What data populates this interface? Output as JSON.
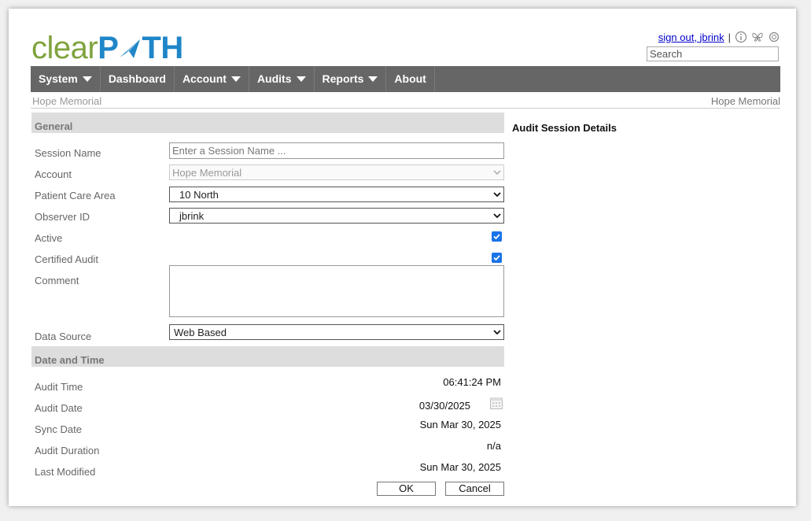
{
  "logo": {
    "part1": "clear",
    "part2": "P",
    "part3": "TH"
  },
  "user": {
    "signout": "sign out, jbrink",
    "separator": "|"
  },
  "search": {
    "placeholder": "Search"
  },
  "nav": [
    {
      "label": "System",
      "dropdown": true
    },
    {
      "label": "Dashboard",
      "dropdown": false
    },
    {
      "label": "Account",
      "dropdown": true
    },
    {
      "label": "Audits",
      "dropdown": true
    },
    {
      "label": "Reports",
      "dropdown": true
    },
    {
      "label": "About",
      "dropdown": false
    }
  ],
  "breadcrumb": {
    "left": "Hope Memorial",
    "right": "Hope Memorial"
  },
  "general": {
    "title": "General",
    "session_name": {
      "label": "Session Name",
      "placeholder": "Enter a Session Name ..."
    },
    "account": {
      "label": "Account",
      "value": "Hope Memorial"
    },
    "patient_care_area": {
      "label": "Patient Care Area",
      "value": "10 North"
    },
    "observer_id": {
      "label": "Observer ID",
      "value": "jbrink"
    },
    "active": {
      "label": "Active",
      "checked": true
    },
    "certified_audit": {
      "label": "Certified Audit",
      "checked": true
    },
    "comment": {
      "label": "Comment",
      "value": ""
    },
    "data_source": {
      "label": "Data Source",
      "value": "Web Based"
    }
  },
  "date_time": {
    "title": "Date and Time",
    "audit_time": {
      "label": "Audit Time",
      "value": "06:41:24 PM"
    },
    "audit_date": {
      "label": "Audit Date",
      "value": "03/30/2025"
    },
    "sync_date": {
      "label": "Sync Date",
      "value": "Sun Mar 30, 2025"
    },
    "audit_duration": {
      "label": "Audit Duration",
      "value": "n/a"
    },
    "last_modified": {
      "label": "Last Modified",
      "value": "Sun Mar 30, 2025"
    }
  },
  "details": {
    "title": "Audit Session Details"
  },
  "buttons": {
    "ok": "OK",
    "cancel": "Cancel"
  },
  "colors": {
    "nav_bg": "#666666",
    "logo_green": "#7fa33d",
    "logo_blue": "#1f86c8",
    "checkbox": "#1a73e8"
  }
}
